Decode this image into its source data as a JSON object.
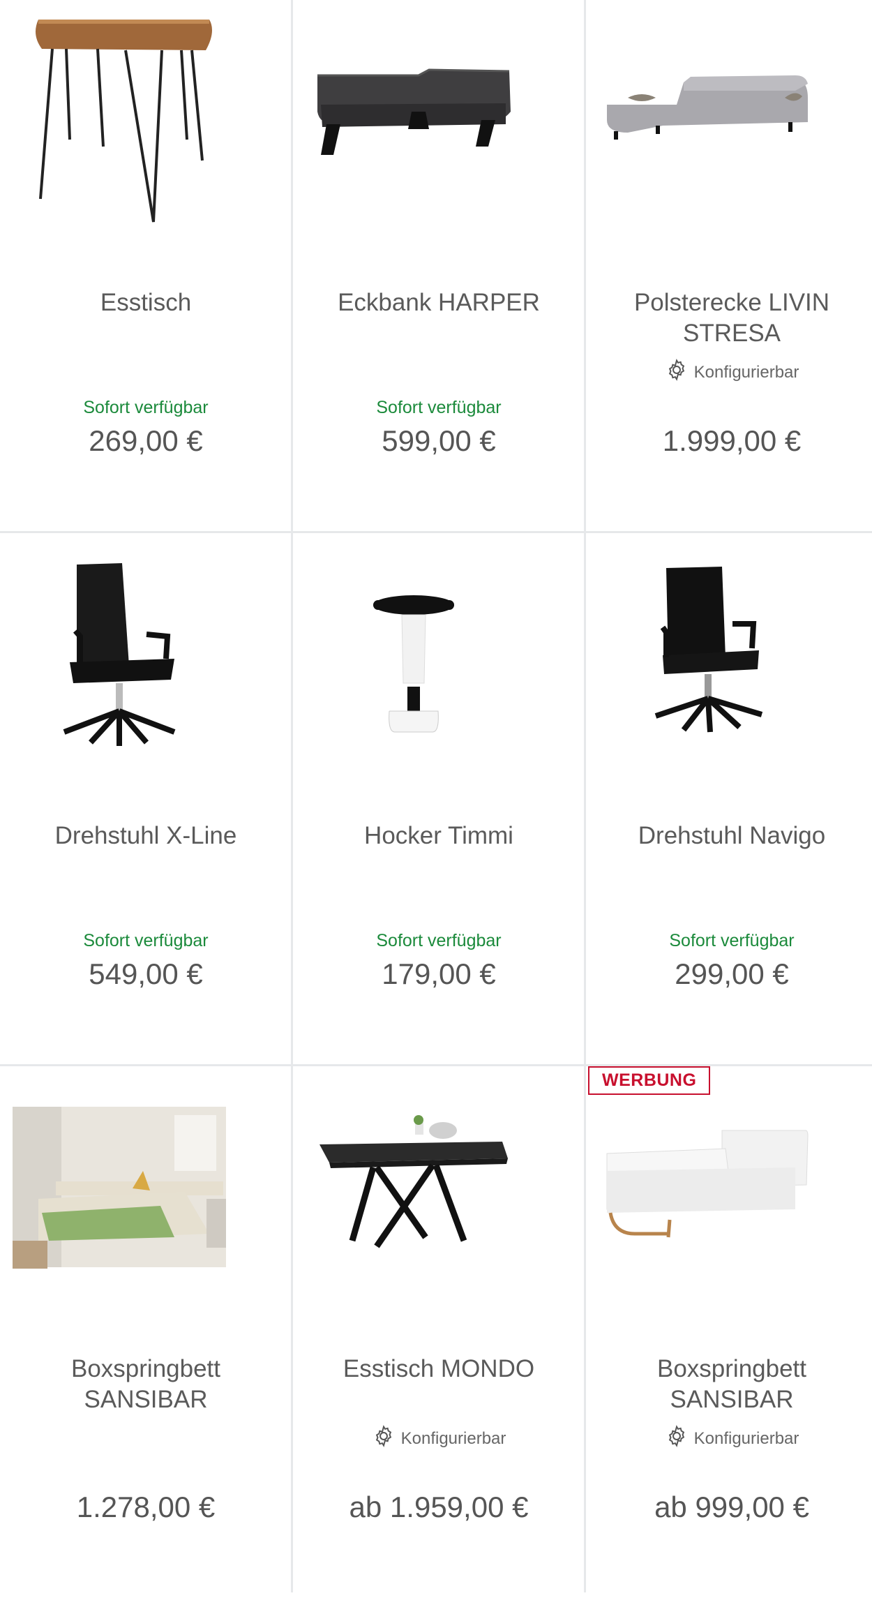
{
  "products": [
    {
      "title": "Esstisch",
      "availability": "Sofort verfügbar",
      "price": "269,00 €",
      "configurable": ""
    },
    {
      "title": "Eckbank HARPER",
      "availability": "Sofort verfügbar",
      "price": "599,00 €",
      "configurable": ""
    },
    {
      "title": "Polsterecke LIVIN STRESA",
      "availability": "",
      "price": "1.999,00 €",
      "configurable": "Konfigurierbar"
    },
    {
      "title": "Drehstuhl X-Line",
      "availability": "Sofort verfügbar",
      "price": "549,00 €",
      "configurable": ""
    },
    {
      "title": "Hocker Timmi",
      "availability": "Sofort verfügbar",
      "price": "179,00 €",
      "configurable": ""
    },
    {
      "title": "Drehstuhl Navigo",
      "availability": "Sofort verfügbar",
      "price": "299,00 €",
      "configurable": ""
    },
    {
      "title": "Boxspringbett SANSIBAR",
      "availability": "",
      "price": "1.278,00 €",
      "configurable": ""
    },
    {
      "title": "Esstisch MONDO",
      "availability": "",
      "price": "ab 1.959,00 €",
      "configurable": "Konfigurierbar"
    },
    {
      "title": "Boxspringbett SANSIBAR",
      "availability": "",
      "price": "ab 999,00 €",
      "configurable": "Konfigurierbar",
      "badge": "WERBUNG"
    }
  ],
  "colors": {
    "available": "#1b8a3b",
    "badge": "#c8102e",
    "divider": "#e6e8ea"
  }
}
